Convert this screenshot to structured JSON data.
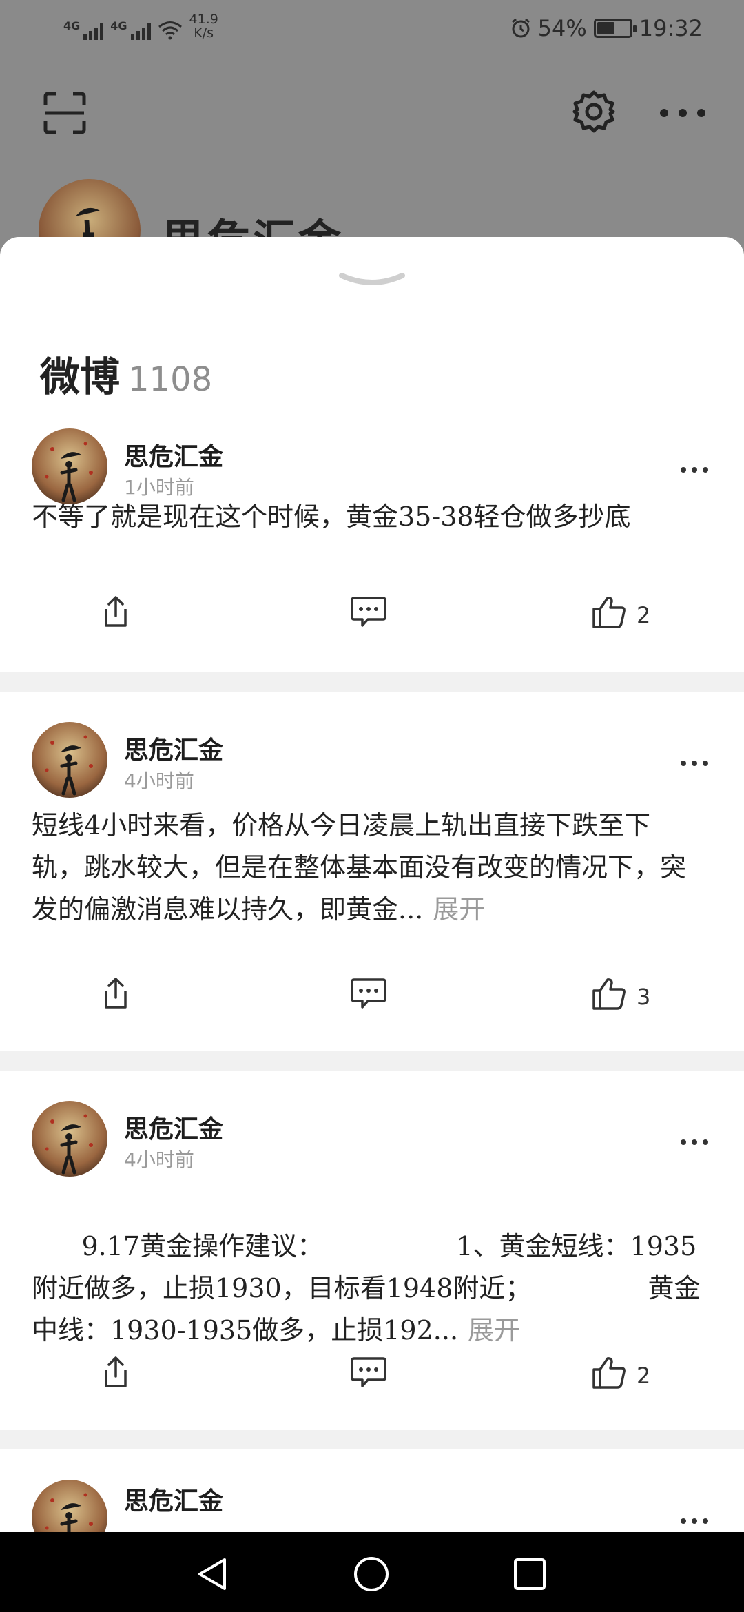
{
  "status_bar": {
    "network1": "4G",
    "network2": "4G",
    "speed_value": "41.9",
    "speed_unit": "K/s",
    "battery_pct": "54%",
    "battery_level": 0.54,
    "time": "19:32"
  },
  "profile": {
    "name": "思危汇金"
  },
  "sheet": {
    "title": "微博",
    "count": "1108"
  },
  "posts": [
    {
      "author": "思危汇金",
      "time": "1小时前",
      "text": "不等了就是现在这个时候，黄金35-38轻仓做多抄底",
      "expand": "",
      "likes": "2"
    },
    {
      "author": "思危汇金",
      "time": "4小时前",
      "text": "短线4小时来看，价格从今日凌晨上轨出直接下跌至下轨，跳水较大，但是在整体基本面没有改变的情况下，突发的偏激消息难以持久，即黄金...",
      "expand": "展开",
      "likes": "3"
    },
    {
      "author": "思危汇金",
      "time": "4小时前",
      "text": "9.17黄金操作建议：                1、黄金短线：1935附近做多，止损1930，目标看1948附近；              黄金中线：1930-1935做多，止损192...",
      "expand": "展开",
      "likes": "2"
    },
    {
      "author": "思危汇金"
    }
  ]
}
